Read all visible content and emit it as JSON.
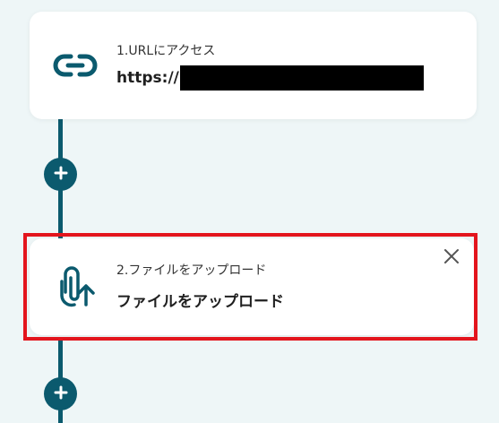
{
  "steps": [
    {
      "label": "1.URLにアクセス",
      "title": "https://",
      "icon": "link-icon"
    },
    {
      "label": "2.ファイルをアップロード",
      "title": "ファイルをアップロード",
      "icon": "attachment-upload-icon"
    }
  ],
  "colors": {
    "accent": "#0b5a6e",
    "background": "#eef6f7",
    "highlight": "#e3151d"
  }
}
